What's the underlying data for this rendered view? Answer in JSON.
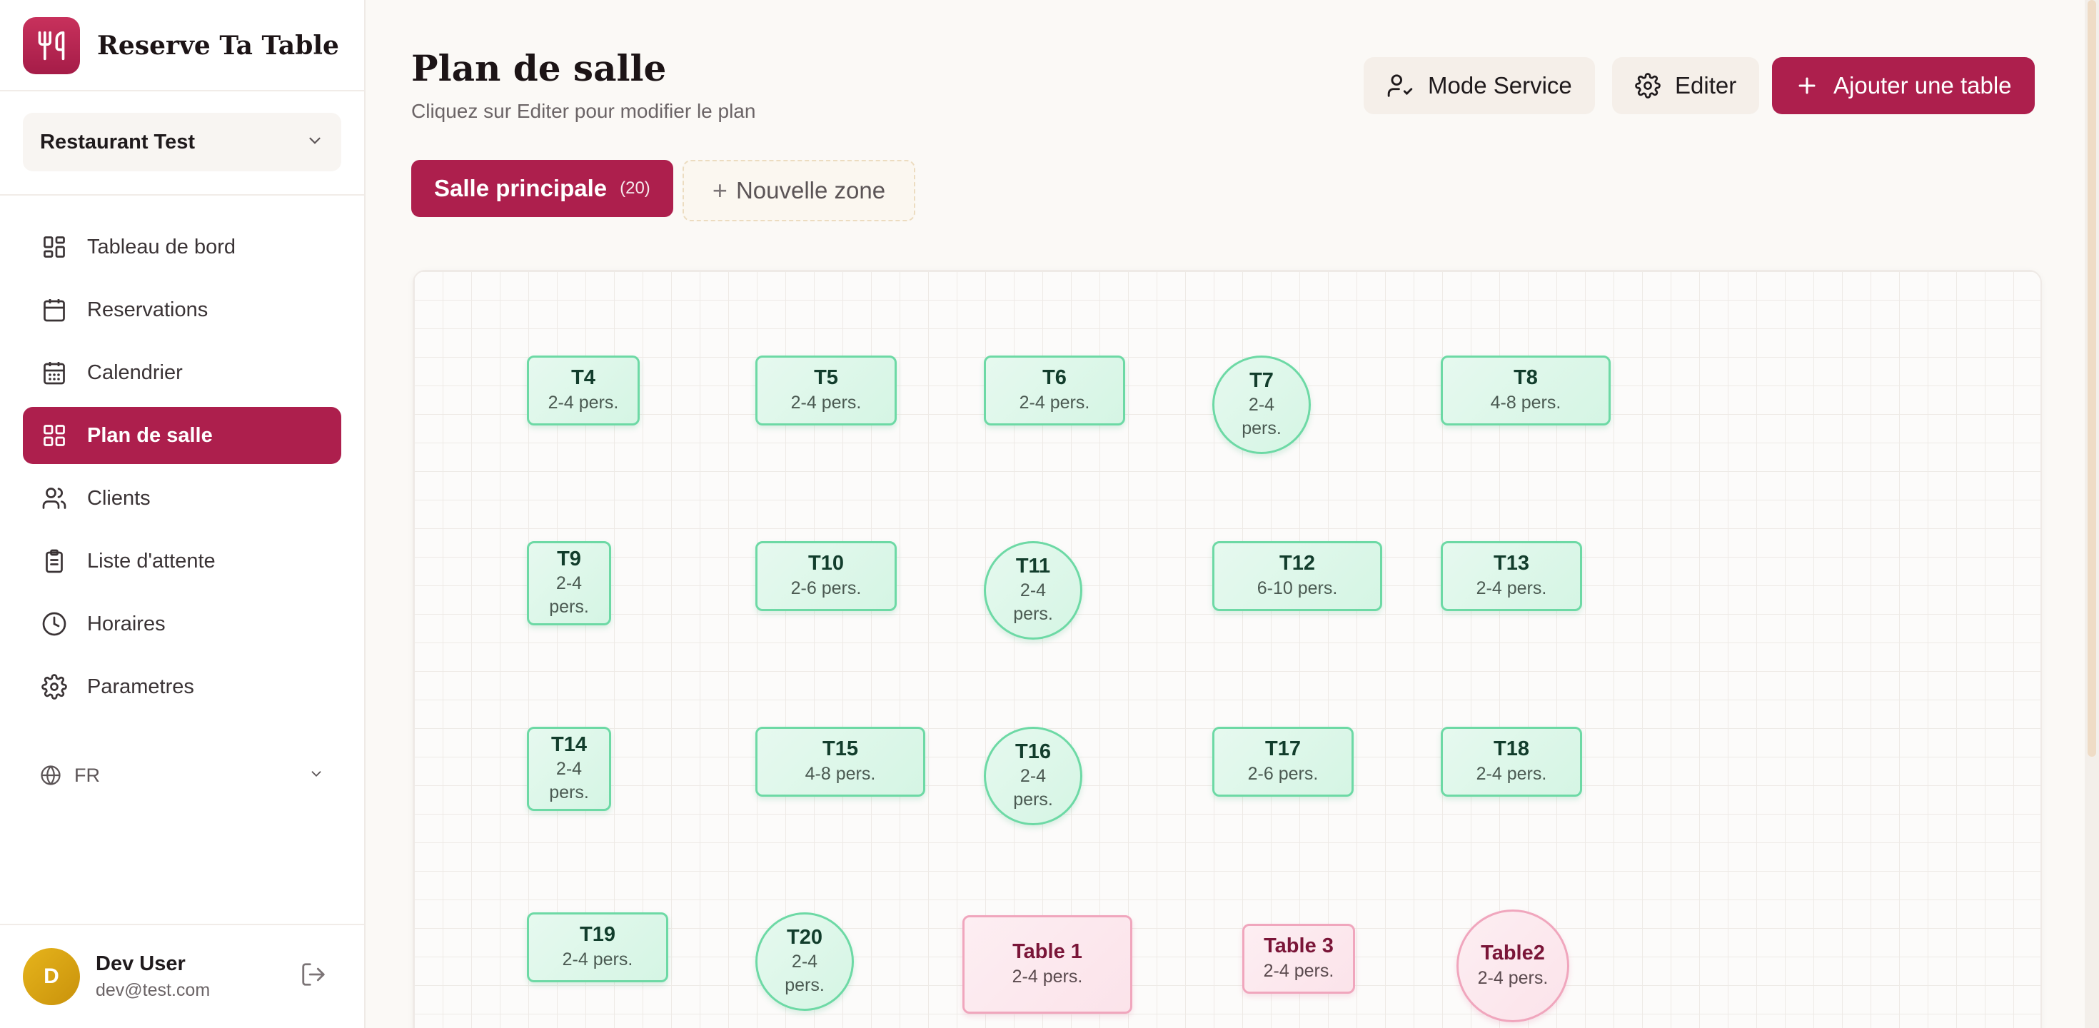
{
  "brand": {
    "name": "Reserve Ta Table",
    "logo_icon": "fork-knife-icon"
  },
  "restaurant_select": {
    "value": "Restaurant Test"
  },
  "nav": [
    {
      "label": "Tableau de bord",
      "icon": "dashboard-icon",
      "active": false
    },
    {
      "label": "Reservations",
      "icon": "calendar-icon",
      "active": false
    },
    {
      "label": "Calendrier",
      "icon": "calendar-grid-icon",
      "active": false
    },
    {
      "label": "Plan de salle",
      "icon": "layout-grid-icon",
      "active": true
    },
    {
      "label": "Clients",
      "icon": "users-icon",
      "active": false
    },
    {
      "label": "Liste d'attente",
      "icon": "clipboard-icon",
      "active": false
    },
    {
      "label": "Horaires",
      "icon": "clock-icon",
      "active": false
    },
    {
      "label": "Parametres",
      "icon": "gear-icon",
      "active": false
    }
  ],
  "language": {
    "value": "FR"
  },
  "user": {
    "initial": "D",
    "name": "Dev User",
    "email": "dev@test.com"
  },
  "header": {
    "title": "Plan de salle",
    "subtitle": "Cliquez sur Editer pour modifier le plan",
    "mode_service_label": "Mode Service",
    "edit_label": "Editer",
    "add_table_label": "Ajouter une table"
  },
  "zones": {
    "active_label": "Salle principale",
    "active_count": "(20)",
    "new_zone_label": "Nouvelle zone"
  },
  "colors": {
    "accent": "#ad1f4d",
    "table_available": "#6dd9a5",
    "table_pink": "#f0a6bd"
  },
  "tables": [
    {
      "name": "T4",
      "capacity": "2-4 pers.",
      "shape": "rect",
      "status": "green"
    },
    {
      "name": "T5",
      "capacity": "2-4 pers.",
      "shape": "rect",
      "status": "green"
    },
    {
      "name": "T6",
      "capacity": "2-4 pers.",
      "shape": "rect",
      "status": "green"
    },
    {
      "name": "T7",
      "capacity": "2-4 pers.",
      "shape": "round",
      "status": "green"
    },
    {
      "name": "T8",
      "capacity": "4-8 pers.",
      "shape": "rect",
      "status": "green"
    },
    {
      "name": "T9",
      "capacity": "2-4 pers.",
      "shape": "rect",
      "status": "green"
    },
    {
      "name": "T10",
      "capacity": "2-6 pers.",
      "shape": "rect",
      "status": "green"
    },
    {
      "name": "T11",
      "capacity": "2-4 pers.",
      "shape": "round",
      "status": "green"
    },
    {
      "name": "T12",
      "capacity": "6-10 pers.",
      "shape": "rect",
      "status": "green"
    },
    {
      "name": "T13",
      "capacity": "2-4 pers.",
      "shape": "rect",
      "status": "green"
    },
    {
      "name": "T14",
      "capacity": "2-4 pers.",
      "shape": "rect",
      "status": "green"
    },
    {
      "name": "T15",
      "capacity": "4-8 pers.",
      "shape": "rect",
      "status": "green"
    },
    {
      "name": "T16",
      "capacity": "2-4 pers.",
      "shape": "round",
      "status": "green"
    },
    {
      "name": "T17",
      "capacity": "2-6 pers.",
      "shape": "rect",
      "status": "green"
    },
    {
      "name": "T18",
      "capacity": "2-4 pers.",
      "shape": "rect",
      "status": "green"
    },
    {
      "name": "T19",
      "capacity": "2-4 pers.",
      "shape": "rect",
      "status": "green"
    },
    {
      "name": "T20",
      "capacity": "2-4 pers.",
      "shape": "round",
      "status": "green"
    },
    {
      "name": "Table 1",
      "capacity": "2-4 pers.",
      "shape": "rect",
      "status": "pink"
    },
    {
      "name": "Table 3",
      "capacity": "2-4 pers.",
      "shape": "rect",
      "status": "pink"
    },
    {
      "name": "Table2",
      "capacity": "2-4 pers.",
      "shape": "round",
      "status": "pink"
    }
  ]
}
